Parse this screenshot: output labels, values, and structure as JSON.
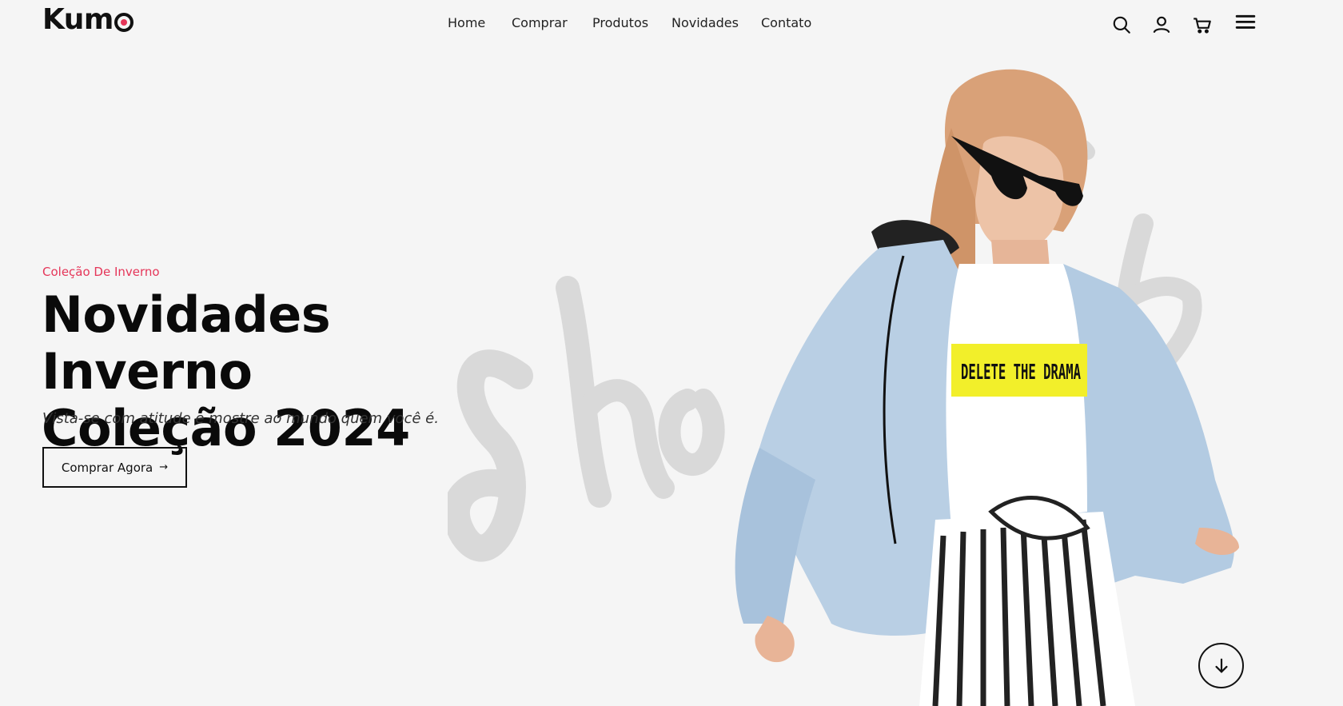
{
  "brand": {
    "name": "Kum",
    "accent": "#e53659"
  },
  "nav": {
    "items": [
      {
        "label": "Home"
      },
      {
        "label": "Comprar"
      },
      {
        "label": "Produtos"
      },
      {
        "label": "Novidades"
      },
      {
        "label": "Contato"
      }
    ]
  },
  "header_icons": [
    "search-icon",
    "user-icon",
    "cart-icon",
    "menu-icon"
  ],
  "hero": {
    "eyebrow": "Coleção De Inverno",
    "title_line1": "Novidades Inverno",
    "title_line2": "Coleção 2024",
    "subtitle": "Vista-se com atitude e mostre ao mundo quem você é.",
    "cta_label": "Comprar Agora",
    "cta_arrow": "→",
    "tshirt_print": "DELETE THE DRAMA"
  },
  "scroll_icon": "arrow-down-icon"
}
